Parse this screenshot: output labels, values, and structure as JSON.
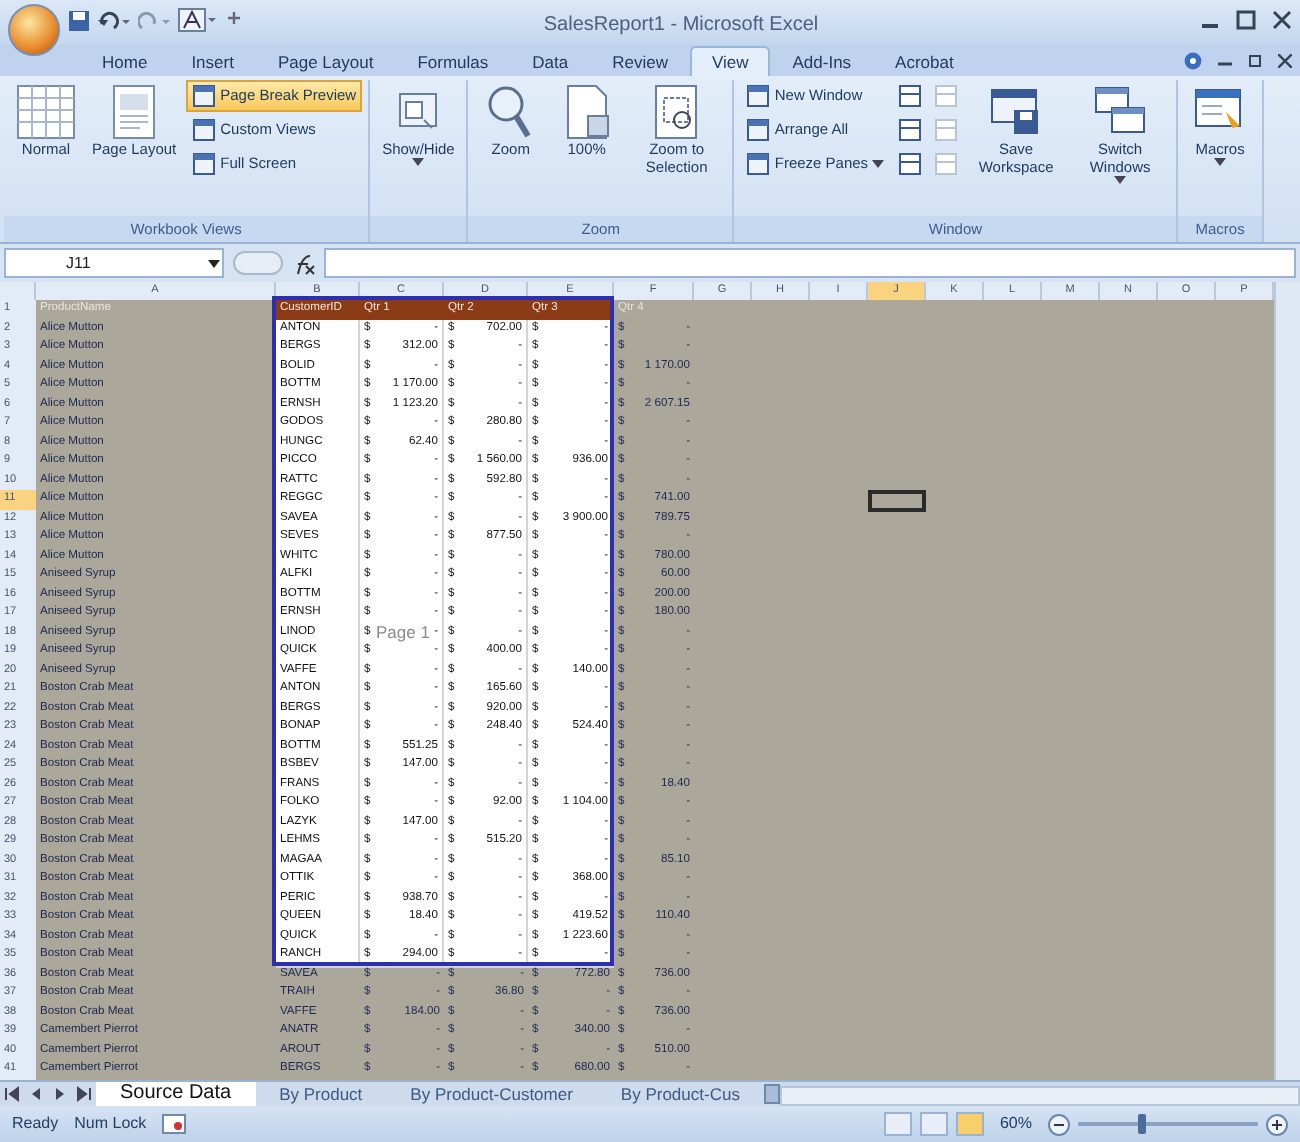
{
  "window": {
    "title": "SalesReport1 - Microsoft Excel"
  },
  "ribbon_tabs": [
    {
      "label": "Home",
      "selected": false
    },
    {
      "label": "Insert",
      "selected": false
    },
    {
      "label": "Page Layout",
      "selected": false
    },
    {
      "label": "Formulas",
      "selected": false
    },
    {
      "label": "Data",
      "selected": false
    },
    {
      "label": "Review",
      "selected": false
    },
    {
      "label": "View",
      "selected": true
    },
    {
      "label": "Add-Ins",
      "selected": false
    },
    {
      "label": "Acrobat",
      "selected": false
    }
  ],
  "ribbon_groups": [
    {
      "label": "Workbook Views",
      "items": [
        {
          "kind": "large",
          "label": "Normal",
          "selected": false
        },
        {
          "kind": "large",
          "label": "Page Layout",
          "selected": false
        },
        {
          "kind": "small",
          "label": "Page Break Preview",
          "selected": true
        },
        {
          "kind": "small",
          "label": "Custom Views",
          "selected": false
        },
        {
          "kind": "small",
          "label": "Full Screen",
          "selected": false
        }
      ]
    },
    {
      "items": [
        {
          "kind": "large",
          "label": "Show/Hide",
          "menu": true
        }
      ]
    },
    {
      "label": "Zoom",
      "items": [
        {
          "kind": "large",
          "label": "Zoom"
        },
        {
          "kind": "large",
          "label": "100%"
        },
        {
          "kind": "large",
          "label": "Zoom to Selection"
        }
      ]
    },
    {
      "label": "Window",
      "items": [
        {
          "kind": "small",
          "label": "New Window"
        },
        {
          "kind": "small",
          "label": "Arrange All"
        },
        {
          "kind": "small",
          "label": "Freeze Panes",
          "menu": true
        },
        {
          "kind": "icon"
        },
        {
          "kind": "icon"
        },
        {
          "kind": "icon"
        },
        {
          "kind": "icon",
          "disabled": true
        },
        {
          "kind": "icon",
          "disabled": true
        },
        {
          "kind": "icon",
          "disabled": true
        },
        {
          "kind": "large",
          "label": "Save Workspace"
        },
        {
          "kind": "large",
          "label": "Switch Windows",
          "menu": true
        }
      ]
    },
    {
      "label": "Macros",
      "items": [
        {
          "kind": "large",
          "label": "Macros",
          "menu": true
        }
      ]
    }
  ],
  "name_box": "J11",
  "columns": [
    {
      "letter": "A",
      "selected": false
    },
    {
      "letter": "B",
      "selected": false
    },
    {
      "letter": "C",
      "selected": false
    },
    {
      "letter": "D",
      "selected": false
    },
    {
      "letter": "E",
      "selected": false
    },
    {
      "letter": "F",
      "selected": false
    },
    {
      "letter": "G",
      "selected": false
    },
    {
      "letter": "H",
      "selected": false
    },
    {
      "letter": "I",
      "selected": false
    },
    {
      "letter": "J",
      "selected": true
    },
    {
      "letter": "K",
      "selected": false
    },
    {
      "letter": "L",
      "selected": false
    },
    {
      "letter": "M",
      "selected": false
    },
    {
      "letter": "N",
      "selected": false
    },
    {
      "letter": "O",
      "selected": false
    },
    {
      "letter": "P",
      "selected": false
    }
  ],
  "header_row": {
    "number": "1",
    "selected": false,
    "cells": [
      "ProductName",
      "CustomerID",
      "Qtr 1",
      "Qtr 2",
      "Qtr 3",
      "Qtr 4"
    ]
  },
  "rows": [
    {
      "number": "2",
      "selected": false,
      "product": "Alice Mutton",
      "customer": "ANTON",
      "values": [
        [
          "$",
          "-"
        ],
        [
          "$",
          "702.00"
        ],
        [
          "$",
          "-"
        ],
        [
          "$",
          "-"
        ]
      ]
    },
    {
      "number": "3",
      "selected": false,
      "product": "Alice Mutton",
      "customer": "BERGS",
      "values": [
        [
          "$",
          "312.00"
        ],
        [
          "$",
          "-"
        ],
        [
          "$",
          "-"
        ],
        [
          "$",
          "-"
        ]
      ]
    },
    {
      "number": "4",
      "selected": false,
      "product": "Alice Mutton",
      "customer": "BOLID",
      "values": [
        [
          "$",
          "-"
        ],
        [
          "$",
          "-"
        ],
        [
          "$",
          "-"
        ],
        [
          "$",
          "1 170.00"
        ]
      ]
    },
    {
      "number": "5",
      "selected": false,
      "product": "Alice Mutton",
      "customer": "BOTTM",
      "values": [
        [
          "$",
          "1 170.00"
        ],
        [
          "$",
          "-"
        ],
        [
          "$",
          "-"
        ],
        [
          "$",
          "-"
        ]
      ]
    },
    {
      "number": "6",
      "selected": false,
      "product": "Alice Mutton",
      "customer": "ERNSH",
      "values": [
        [
          "$",
          "1 123.20"
        ],
        [
          "$",
          "-"
        ],
        [
          "$",
          "-"
        ],
        [
          "$",
          "2 607.15"
        ]
      ]
    },
    {
      "number": "7",
      "selected": false,
      "product": "Alice Mutton",
      "customer": "GODOS",
      "values": [
        [
          "$",
          "-"
        ],
        [
          "$",
          "280.80"
        ],
        [
          "$",
          "-"
        ],
        [
          "$",
          "-"
        ]
      ]
    },
    {
      "number": "8",
      "selected": false,
      "product": "Alice Mutton",
      "customer": "HUNGC",
      "values": [
        [
          "$",
          "62.40"
        ],
        [
          "$",
          "-"
        ],
        [
          "$",
          "-"
        ],
        [
          "$",
          "-"
        ]
      ]
    },
    {
      "number": "9",
      "selected": false,
      "product": "Alice Mutton",
      "customer": "PICCO",
      "values": [
        [
          "$",
          "-"
        ],
        [
          "$",
          "1 560.00"
        ],
        [
          "$",
          "936.00"
        ],
        [
          "$",
          "-"
        ]
      ]
    },
    {
      "number": "10",
      "selected": false,
      "product": "Alice Mutton",
      "customer": "RATTC",
      "values": [
        [
          "$",
          "-"
        ],
        [
          "$",
          "592.80"
        ],
        [
          "$",
          "-"
        ],
        [
          "$",
          "-"
        ]
      ]
    },
    {
      "number": "11",
      "selected": true,
      "product": "Alice Mutton",
      "customer": "REGGC",
      "values": [
        [
          "$",
          "-"
        ],
        [
          "$",
          "-"
        ],
        [
          "$",
          "-"
        ],
        [
          "$",
          "741.00"
        ]
      ]
    },
    {
      "number": "12",
      "selected": false,
      "product": "Alice Mutton",
      "customer": "SAVEA",
      "values": [
        [
          "$",
          "-"
        ],
        [
          "$",
          "-"
        ],
        [
          "$",
          "3 900.00"
        ],
        [
          "$",
          "789.75"
        ]
      ]
    },
    {
      "number": "13",
      "selected": false,
      "product": "Alice Mutton",
      "customer": "SEVES",
      "values": [
        [
          "$",
          "-"
        ],
        [
          "$",
          "877.50"
        ],
        [
          "$",
          "-"
        ],
        [
          "$",
          "-"
        ]
      ]
    },
    {
      "number": "14",
      "selected": false,
      "product": "Alice Mutton",
      "customer": "WHITC",
      "values": [
        [
          "$",
          "-"
        ],
        [
          "$",
          "-"
        ],
        [
          "$",
          "-"
        ],
        [
          "$",
          "780.00"
        ]
      ]
    },
    {
      "number": "15",
      "selected": false,
      "product": "Aniseed Syrup",
      "customer": "ALFKI",
      "values": [
        [
          "$",
          "-"
        ],
        [
          "$",
          "-"
        ],
        [
          "$",
          "-"
        ],
        [
          "$",
          "60.00"
        ]
      ]
    },
    {
      "number": "16",
      "selected": false,
      "product": "Aniseed Syrup",
      "customer": "BOTTM",
      "values": [
        [
          "$",
          "-"
        ],
        [
          "$",
          "-"
        ],
        [
          "$",
          "-"
        ],
        [
          "$",
          "200.00"
        ]
      ]
    },
    {
      "number": "17",
      "selected": false,
      "product": "Aniseed Syrup",
      "customer": "ERNSH",
      "values": [
        [
          "$",
          "-"
        ],
        [
          "$",
          "-"
        ],
        [
          "$",
          "-"
        ],
        [
          "$",
          "180.00"
        ]
      ]
    },
    {
      "number": "18",
      "selected": false,
      "product": "Aniseed Syrup",
      "customer": "LINOD",
      "values": [
        [
          "$",
          "-"
        ],
        [
          "$",
          "-"
        ],
        [
          "$",
          "-"
        ],
        [
          "$",
          "-"
        ]
      ]
    },
    {
      "number": "19",
      "selected": false,
      "product": "Aniseed Syrup",
      "customer": "QUICK",
      "values": [
        [
          "$",
          "-"
        ],
        [
          "$",
          "400.00"
        ],
        [
          "$",
          "-"
        ],
        [
          "$",
          "-"
        ]
      ]
    },
    {
      "number": "20",
      "selected": false,
      "product": "Aniseed Syrup",
      "customer": "VAFFE",
      "values": [
        [
          "$",
          "-"
        ],
        [
          "$",
          "-"
        ],
        [
          "$",
          "140.00"
        ],
        [
          "$",
          "-"
        ]
      ]
    },
    {
      "number": "21",
      "selected": false,
      "product": "Boston Crab Meat",
      "customer": "ANTON",
      "values": [
        [
          "$",
          "-"
        ],
        [
          "$",
          "165.60"
        ],
        [
          "$",
          "-"
        ],
        [
          "$",
          "-"
        ]
      ]
    },
    {
      "number": "22",
      "selected": false,
      "product": "Boston Crab Meat",
      "customer": "BERGS",
      "values": [
        [
          "$",
          "-"
        ],
        [
          "$",
          "920.00"
        ],
        [
          "$",
          "-"
        ],
        [
          "$",
          "-"
        ]
      ]
    },
    {
      "number": "23",
      "selected": false,
      "product": "Boston Crab Meat",
      "customer": "BONAP",
      "values": [
        [
          "$",
          "-"
        ],
        [
          "$",
          "248.40"
        ],
        [
          "$",
          "524.40"
        ],
        [
          "$",
          "-"
        ]
      ]
    },
    {
      "number": "24",
      "selected": false,
      "product": "Boston Crab Meat",
      "customer": "BOTTM",
      "values": [
        [
          "$",
          "551.25"
        ],
        [
          "$",
          "-"
        ],
        [
          "$",
          "-"
        ],
        [
          "$",
          "-"
        ]
      ]
    },
    {
      "number": "25",
      "selected": false,
      "product": "Boston Crab Meat",
      "customer": "BSBEV",
      "values": [
        [
          "$",
          "147.00"
        ],
        [
          "$",
          "-"
        ],
        [
          "$",
          "-"
        ],
        [
          "$",
          "-"
        ]
      ]
    },
    {
      "number": "26",
      "selected": false,
      "product": "Boston Crab Meat",
      "customer": "FRANS",
      "values": [
        [
          "$",
          "-"
        ],
        [
          "$",
          "-"
        ],
        [
          "$",
          "-"
        ],
        [
          "$",
          "18.40"
        ]
      ]
    },
    {
      "number": "27",
      "selected": false,
      "product": "Boston Crab Meat",
      "customer": "FOLKO",
      "values": [
        [
          "$",
          "-"
        ],
        [
          "$",
          "92.00"
        ],
        [
          "$",
          "1 104.00"
        ],
        [
          "$",
          "-"
        ]
      ]
    },
    {
      "number": "28",
      "selected": false,
      "product": "Boston Crab Meat",
      "customer": "LAZYK",
      "values": [
        [
          "$",
          "147.00"
        ],
        [
          "$",
          "-"
        ],
        [
          "$",
          "-"
        ],
        [
          "$",
          "-"
        ]
      ]
    },
    {
      "number": "29",
      "selected": false,
      "product": "Boston Crab Meat",
      "customer": "LEHMS",
      "values": [
        [
          "$",
          "-"
        ],
        [
          "$",
          "515.20"
        ],
        [
          "$",
          "-"
        ],
        [
          "$",
          "-"
        ]
      ]
    },
    {
      "number": "30",
      "selected": false,
      "product": "Boston Crab Meat",
      "customer": "MAGAA",
      "values": [
        [
          "$",
          "-"
        ],
        [
          "$",
          "-"
        ],
        [
          "$",
          "-"
        ],
        [
          "$",
          "85.10"
        ]
      ]
    },
    {
      "number": "31",
      "selected": false,
      "product": "Boston Crab Meat",
      "customer": "OTTIK",
      "values": [
        [
          "$",
          "-"
        ],
        [
          "$",
          "-"
        ],
        [
          "$",
          "368.00"
        ],
        [
          "$",
          "-"
        ]
      ]
    },
    {
      "number": "32",
      "selected": false,
      "product": "Boston Crab Meat",
      "customer": "PERIC",
      "values": [
        [
          "$",
          "938.70"
        ],
        [
          "$",
          "-"
        ],
        [
          "$",
          "-"
        ],
        [
          "$",
          "-"
        ]
      ]
    },
    {
      "number": "33",
      "selected": false,
      "product": "Boston Crab Meat",
      "customer": "QUEEN",
      "values": [
        [
          "$",
          "18.40"
        ],
        [
          "$",
          "-"
        ],
        [
          "$",
          "419.52"
        ],
        [
          "$",
          "110.40"
        ]
      ]
    },
    {
      "number": "34",
      "selected": false,
      "product": "Boston Crab Meat",
      "customer": "QUICK",
      "values": [
        [
          "$",
          "-"
        ],
        [
          "$",
          "-"
        ],
        [
          "$",
          "1 223.60"
        ],
        [
          "$",
          "-"
        ]
      ]
    },
    {
      "number": "35",
      "selected": false,
      "product": "Boston Crab Meat",
      "customer": "RANCH",
      "values": [
        [
          "$",
          "294.00"
        ],
        [
          "$",
          "-"
        ],
        [
          "$",
          "-"
        ],
        [
          "$",
          "-"
        ]
      ]
    },
    {
      "number": "36",
      "selected": false,
      "product": "Boston Crab Meat",
      "customer": "SAVEA",
      "values": [
        [
          "$",
          "-"
        ],
        [
          "$",
          "-"
        ],
        [
          "$",
          "772.80"
        ],
        [
          "$",
          "736.00"
        ]
      ]
    },
    {
      "number": "37",
      "selected": false,
      "product": "Boston Crab Meat",
      "customer": "TRAIH",
      "values": [
        [
          "$",
          "-"
        ],
        [
          "$",
          "36.80"
        ],
        [
          "$",
          "-"
        ],
        [
          "$",
          "-"
        ]
      ]
    },
    {
      "number": "38",
      "selected": false,
      "product": "Boston Crab Meat",
      "customer": "VAFFE",
      "values": [
        [
          "$",
          "184.00"
        ],
        [
          "$",
          "-"
        ],
        [
          "$",
          "-"
        ],
        [
          "$",
          "736.00"
        ]
      ]
    },
    {
      "number": "39",
      "selected": false,
      "product": "Camembert Pierrot",
      "customer": "ANATR",
      "values": [
        [
          "$",
          "-"
        ],
        [
          "$",
          "-"
        ],
        [
          "$",
          "340.00"
        ],
        [
          "$",
          "-"
        ]
      ]
    },
    {
      "number": "40",
      "selected": false,
      "product": "Camembert Pierrot",
      "customer": "AROUT",
      "values": [
        [
          "$",
          "-"
        ],
        [
          "$",
          "-"
        ],
        [
          "$",
          "-"
        ],
        [
          "$",
          "510.00"
        ]
      ]
    },
    {
      "number": "41",
      "selected": false,
      "product": "Camembert Pierrot",
      "customer": "BERGS",
      "values": [
        [
          "$",
          "-"
        ],
        [
          "$",
          "-"
        ],
        [
          "$",
          "680.00"
        ],
        [
          "$",
          "-"
        ]
      ]
    }
  ],
  "page_label": "Page 1",
  "sheet_tabs": [
    {
      "label": "Source Data",
      "selected": true
    },
    {
      "label": "By Product",
      "selected": false
    },
    {
      "label": "By Product-Customer",
      "selected": false
    },
    {
      "label": "By Product-Cus",
      "selected": false
    }
  ],
  "status_bar": {
    "mode": "Ready",
    "indicator": "Num Lock",
    "views": [
      {
        "selected": false
      },
      {
        "selected": false
      },
      {
        "selected": true
      }
    ],
    "zoom": "60%",
    "zoom_slider": {
      "level": 0.35
    }
  }
}
